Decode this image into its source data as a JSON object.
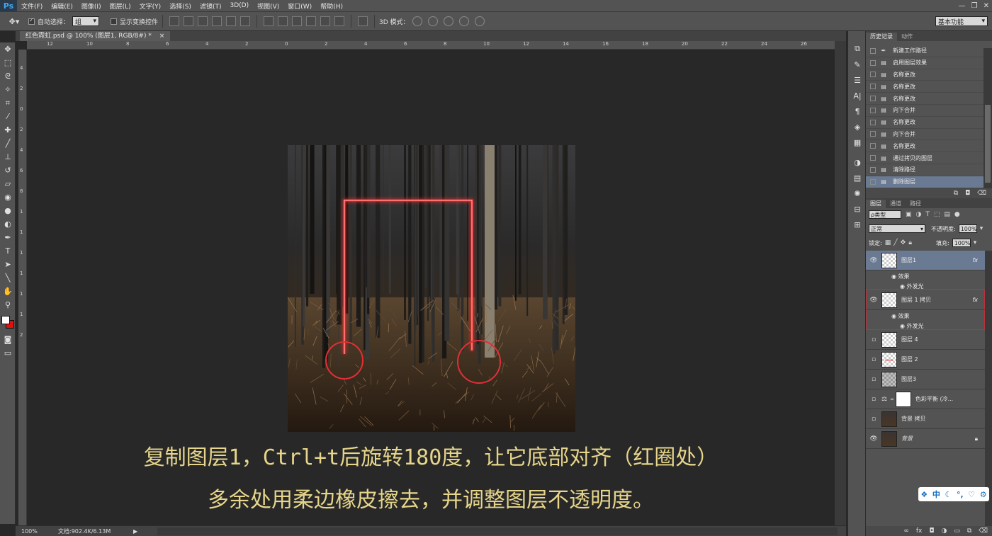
{
  "app": {
    "logo": "Ps",
    "window_controls": [
      "—",
      "❐",
      "✕"
    ]
  },
  "menu": [
    "文件(F)",
    "编辑(E)",
    "图像(I)",
    "图层(L)",
    "文字(Y)",
    "选择(S)",
    "滤镜(T)",
    "3D(D)",
    "视图(V)",
    "窗口(W)",
    "帮助(H)"
  ],
  "options": {
    "auto_select_label": "自动选择：",
    "auto_select_value": "组",
    "show_transform_label": "显示变换控件",
    "mode3d_label": "3D 模式：",
    "workspace": "基本功能"
  },
  "document": {
    "tab_title": "红色霓虹.psd @ 100% (图层1, RGB/8#) *",
    "tab_close": "×",
    "zoom": "100%",
    "doc_info": "文档:902.4K/6.13M"
  },
  "ruler": {
    "top_labels": [
      "12",
      "10",
      "8",
      "6",
      "4",
      "2",
      "0",
      "2",
      "4",
      "6",
      "8",
      "10",
      "12",
      "14",
      "16",
      "18",
      "20",
      "22",
      "24",
      "26"
    ],
    "left_labels": [
      "4",
      "2",
      "0",
      "2",
      "4",
      "6",
      "8",
      "1",
      "1",
      "1",
      "1",
      "1",
      "1",
      "2"
    ]
  },
  "captions": {
    "line1": "复制图层1，Ctrl+t后旋转180度，让它底部对齐（红圈处）",
    "line2": "多余处用柔边橡皮擦去，并调整图层不透明度。"
  },
  "history": {
    "tabs": [
      "历史记录",
      "动作"
    ],
    "items": [
      "新建工作路径",
      "启用图层效果",
      "名称更改",
      "名称更改",
      "名称更改",
      "向下合并",
      "名称更改",
      "向下合并",
      "名称更改",
      "通过拷贝的图层",
      "清除路径",
      "删除图层"
    ]
  },
  "layers": {
    "tabs": [
      "图层",
      "通道",
      "路径"
    ],
    "filter_label": "ρ类型",
    "blend_mode": "正常",
    "opacity_label": "不透明度:",
    "opacity_value": "100%",
    "lock_label": "锁定:",
    "fill_label": "填充:",
    "fill_value": "100%",
    "fx_label": "fx",
    "effects_label": "效果",
    "outer_glow_label": "外发光",
    "items": [
      "图层1",
      "图层 1 拷贝",
      "图层 4",
      "图层 2",
      "图层3",
      "色彩平衡 (冷...",
      "背景 拷贝",
      "背景"
    ]
  },
  "ime": {
    "label": "中"
  },
  "colors": {
    "accent_selection": "#6b7a93",
    "neon": "#ff2a2a",
    "caption": "#e6d58a",
    "highlight_box": "#c0303a"
  }
}
